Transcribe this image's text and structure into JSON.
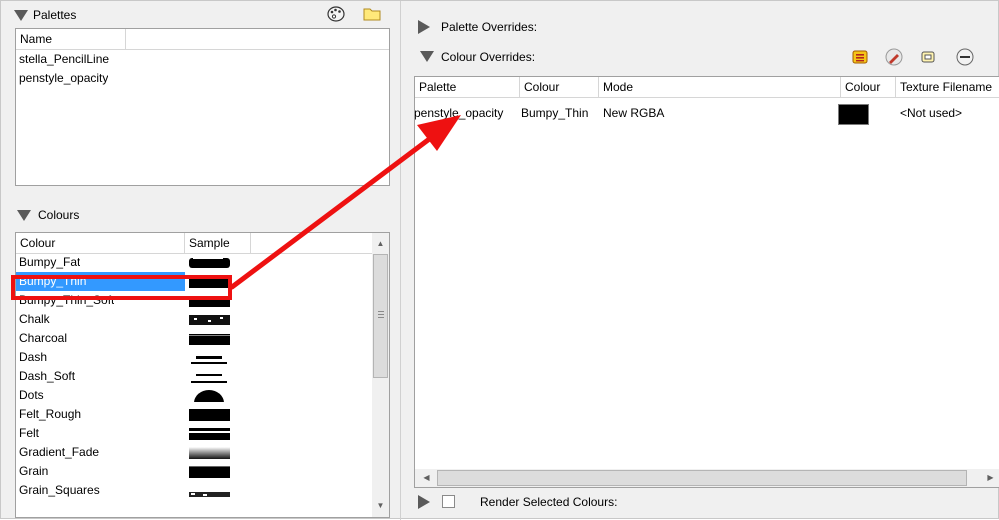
{
  "left_panel": {
    "palettes": {
      "title": "Palettes",
      "header_name": "Name",
      "items": [
        "stella_PencilLine",
        "penstyle_opacity"
      ]
    },
    "colours": {
      "title": "Colours",
      "header_colour": "Colour",
      "header_sample": "Sample",
      "items": [
        {
          "name": "Bumpy_Fat",
          "sample": "bumpy-fat"
        },
        {
          "name": "Bumpy_Thin",
          "sample": "bumpy-thin",
          "selected": true
        },
        {
          "name": "Bumpy_Thin_Soft",
          "sample": "bumpy-thin-soft"
        },
        {
          "name": "Chalk",
          "sample": "chalk"
        },
        {
          "name": "Charcoal",
          "sample": "charcoal"
        },
        {
          "name": "Dash",
          "sample": "dash"
        },
        {
          "name": "Dash_Soft",
          "sample": "dash-soft"
        },
        {
          "name": "Dots",
          "sample": "dots"
        },
        {
          "name": "Felt_Rough",
          "sample": "felt-rough"
        },
        {
          "name": "Felt",
          "sample": "felt"
        },
        {
          "name": "Gradient_Fade",
          "sample": "gradient-fade"
        },
        {
          "name": "Grain",
          "sample": "grain"
        },
        {
          "name": "Grain_Squares",
          "sample": "grain-squares"
        }
      ]
    }
  },
  "right_panel": {
    "palette_overrides_title": "Palette Overrides:",
    "colour_overrides_title": "Colour Overrides:",
    "columns": [
      "Palette",
      "Colour",
      "Mode",
      "Colour",
      "Texture Filename"
    ],
    "rows": [
      {
        "palette": "penstyle_opacity",
        "colour": "Bumpy_Thin",
        "mode": "New RGBA",
        "swatch": "#000000",
        "texture": "<Not used>"
      }
    ],
    "render_selected_label": "Render Selected Colours:"
  },
  "colors": {
    "selection": "#3399ff",
    "highlight_border": "#ee1111",
    "arrow": "#ee1111"
  }
}
